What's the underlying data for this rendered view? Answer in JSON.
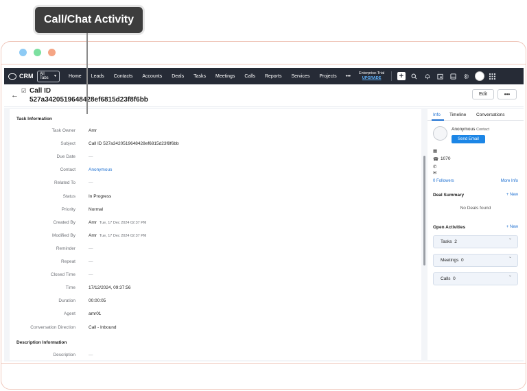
{
  "callout": {
    "label": "Call/Chat Activity"
  },
  "nav": {
    "brand": "CRM",
    "all_tabs_line1": "All",
    "all_tabs_line2": "Tabs",
    "items": [
      "Home",
      "Leads",
      "Contacts",
      "Accounts",
      "Deals",
      "Tasks",
      "Meetings",
      "Calls",
      "Reports",
      "Services",
      "Projects"
    ],
    "more": "•••",
    "trial_line1": "Enterprise-Trial",
    "trial_line2": "UPGRADE"
  },
  "record": {
    "title": "Call ID",
    "id": "527a342051964842​8ef6815d23f8f6bb",
    "edit_label": "Edit",
    "more_label": "•••"
  },
  "task_info": {
    "section_title": "Task Information",
    "fields": [
      {
        "label": "Task Owner",
        "value": "Amr"
      },
      {
        "label": "Subject",
        "value": "Call ID 527a3420519648428ef6815d23f8f6bb"
      },
      {
        "label": "Due Date",
        "value": "—"
      },
      {
        "label": "Contact",
        "value": "Anonymous"
      },
      {
        "label": "Related To",
        "value": "—"
      },
      {
        "label": "Status",
        "value": "In Progress"
      },
      {
        "label": "Priority",
        "value": "Normal"
      },
      {
        "label": "Created By",
        "value": "Amr",
        "timestamp": "Tue, 17 Dec 2024 02:37 PM"
      },
      {
        "label": "Modified By",
        "value": "Amr",
        "timestamp": "Tue, 17 Dec 2024 02:37 PM"
      },
      {
        "label": "Reminder",
        "value": "—"
      },
      {
        "label": "Repeat",
        "value": "—"
      },
      {
        "label": "Closed Time",
        "value": "—"
      },
      {
        "label": "Time",
        "value": "17/12/2024, 09:37:56"
      },
      {
        "label": "Duration",
        "value": "00:00:05"
      },
      {
        "label": "Agent",
        "value": "amr01"
      },
      {
        "label": "Conversation Direction",
        "value": "Call - Inbound"
      }
    ]
  },
  "description_info": {
    "section_title": "Description Information",
    "label": "Description",
    "value": "—"
  },
  "right_panel": {
    "tabs": [
      "Info",
      "Timeline",
      "Conversations"
    ],
    "contact_name": "Anonymous",
    "contact_tag": "Contact",
    "send_email": "Send Email",
    "phone": "1070",
    "followers": "0 Followers",
    "more_info": "More Info",
    "deal_summary": "Deal Summary",
    "new_label": "+ New",
    "no_deals": "No Deals found",
    "open_activities": "Open Activities",
    "activities": [
      {
        "label": "Tasks",
        "count": "2"
      },
      {
        "label": "Meetings",
        "count": "0"
      },
      {
        "label": "Calls",
        "count": "0"
      }
    ]
  }
}
